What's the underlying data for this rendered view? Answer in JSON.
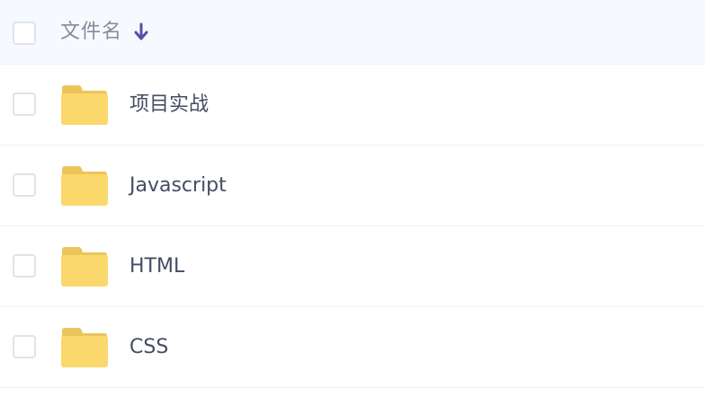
{
  "header": {
    "checkbox_checked": false,
    "column_label": "文件名",
    "sort_direction": "descending",
    "sort_icon": "arrow-down-icon"
  },
  "colors": {
    "header_bg": "#f6f9fd",
    "accent": "#5b4ea8",
    "folder": "#fbd86b",
    "folder_tab": "#ecc55a",
    "text": "#454d64",
    "header_text": "#878c9c"
  },
  "files": [
    {
      "name": "项目实战",
      "type": "folder",
      "icon": "folder-icon",
      "checked": false
    },
    {
      "name": "Javascript",
      "type": "folder",
      "icon": "folder-icon",
      "checked": false
    },
    {
      "name": "HTML",
      "type": "folder",
      "icon": "folder-icon",
      "checked": false
    },
    {
      "name": "CSS",
      "type": "folder",
      "icon": "folder-icon",
      "checked": false
    }
  ]
}
